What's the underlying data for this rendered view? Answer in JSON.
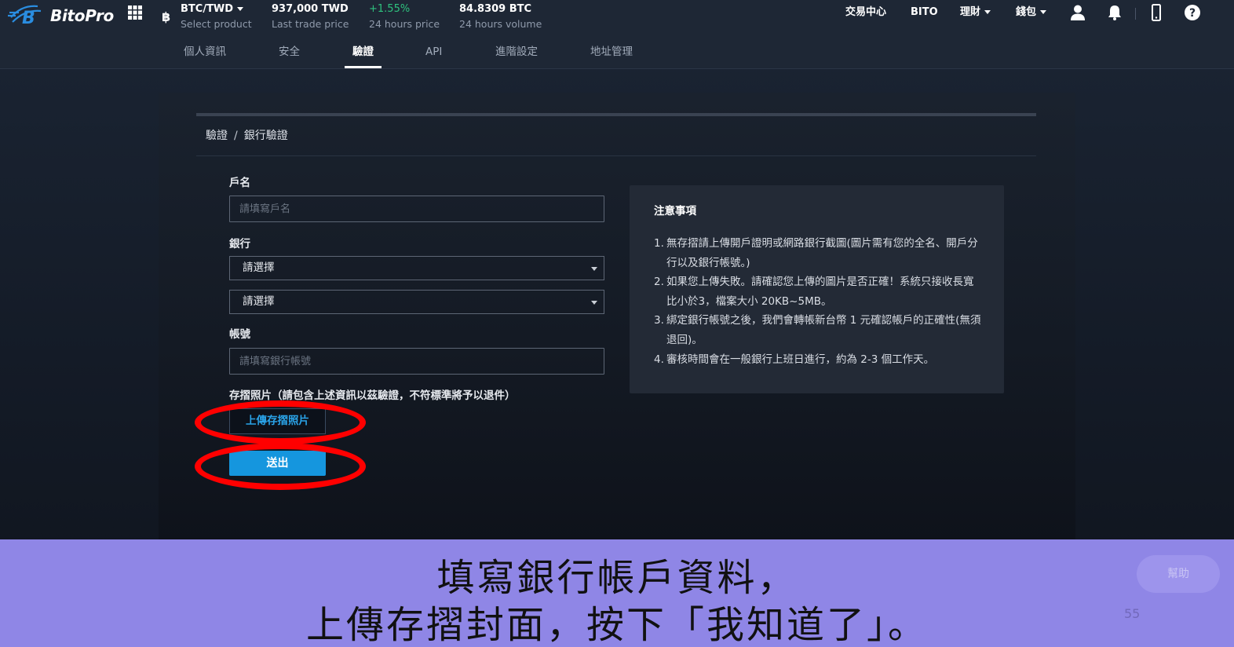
{
  "header": {
    "logo_text": "BitoPro",
    "pair": {
      "value": "BTC/TWD",
      "label": "Select product"
    },
    "last_trade": {
      "value": "937,000 TWD",
      "label": "Last trade price"
    },
    "change": {
      "value": "+1.55%",
      "label": "24 hours price"
    },
    "volume": {
      "value": "84.8309 BTC",
      "label": "24 hours volume"
    },
    "nav": [
      "交易中心",
      "BITO",
      "理財",
      "錢包"
    ],
    "icons": [
      "apps-grid-icon",
      "bitcoin-icon",
      "user-icon",
      "bell-icon",
      "mobile-icon",
      "help-icon"
    ]
  },
  "tabs": [
    {
      "label": "個人資訊",
      "active": false
    },
    {
      "label": "安全",
      "active": false
    },
    {
      "label": "驗證",
      "active": true
    },
    {
      "label": "API",
      "active": false
    },
    {
      "label": "進階設定",
      "active": false
    },
    {
      "label": "地址管理",
      "active": false
    }
  ],
  "breadcrumb": {
    "root": "驗證",
    "separator": "/",
    "current": "銀行驗證"
  },
  "form": {
    "account_name": {
      "label": "戶名",
      "placeholder": "請填寫戶名"
    },
    "bank": {
      "label": "銀行",
      "select_1": "請選擇",
      "select_2": "請選擇"
    },
    "account_number": {
      "label": "帳號",
      "placeholder": "請填寫銀行帳號"
    },
    "photo": {
      "label": "存摺照片（請包含上述資訊以茲驗證，不符標準將予以退件）",
      "upload_label": "上傳存摺照片"
    },
    "submit_label": "送出"
  },
  "notice": {
    "title": "注意事項",
    "items": [
      {
        "num": "1.",
        "text": "無存摺請上傳開戶證明或網路銀行截圖(圖片需有您的全名、開戶分行以及銀行帳號。)"
      },
      {
        "num": "2.",
        "text": "如果您上傳失敗。請確認您上傳的圖片是否正確！系統只接收長寬比小於3，檔案大小 20KB~5MB。"
      },
      {
        "num": "3.",
        "text": "綁定銀行帳號之後，我們會轉帳新台幣 1 元確認帳戶的正確性(無須退回)。"
      },
      {
        "num": "4.",
        "text": "審核時間會在一般銀行上班日進行，約為 2-3 個工作天。"
      }
    ]
  },
  "caption": {
    "line1": "填寫銀行帳戶資料，",
    "line2": "上傳存摺封面，按下「我知道了」。"
  },
  "help_button": "幫助",
  "page_number": "55",
  "colors": {
    "accent_blue": "#1596de",
    "positive_green": "#2ec27e",
    "highlight_red": "#ff0000",
    "caption_band": "#8f86e6"
  }
}
